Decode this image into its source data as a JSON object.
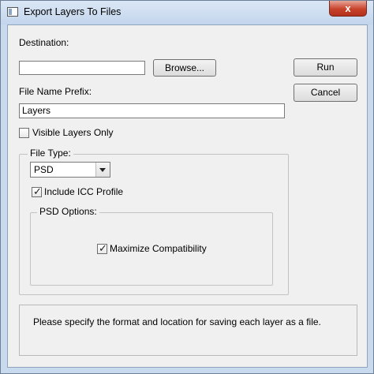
{
  "window": {
    "title": "Export Layers To Files",
    "close_glyph": "x"
  },
  "destination": {
    "label": "Destination:",
    "value": "",
    "browse_label": "Browse..."
  },
  "buttons": {
    "run_label": "Run",
    "cancel_label": "Cancel"
  },
  "prefix": {
    "label": "File Name Prefix:",
    "value": "Layers"
  },
  "visible_only": {
    "label": "Visible Layers Only",
    "checked": false
  },
  "file_type": {
    "legend": "File Type:",
    "selected": "PSD",
    "include_icc": {
      "label": "Include ICC Profile",
      "checked": true
    },
    "psd_options": {
      "legend": "PSD Options:",
      "maximize": {
        "label": "Maximize Compatibility",
        "checked": true
      }
    }
  },
  "message": "Please specify the format and location for saving each layer as a file."
}
